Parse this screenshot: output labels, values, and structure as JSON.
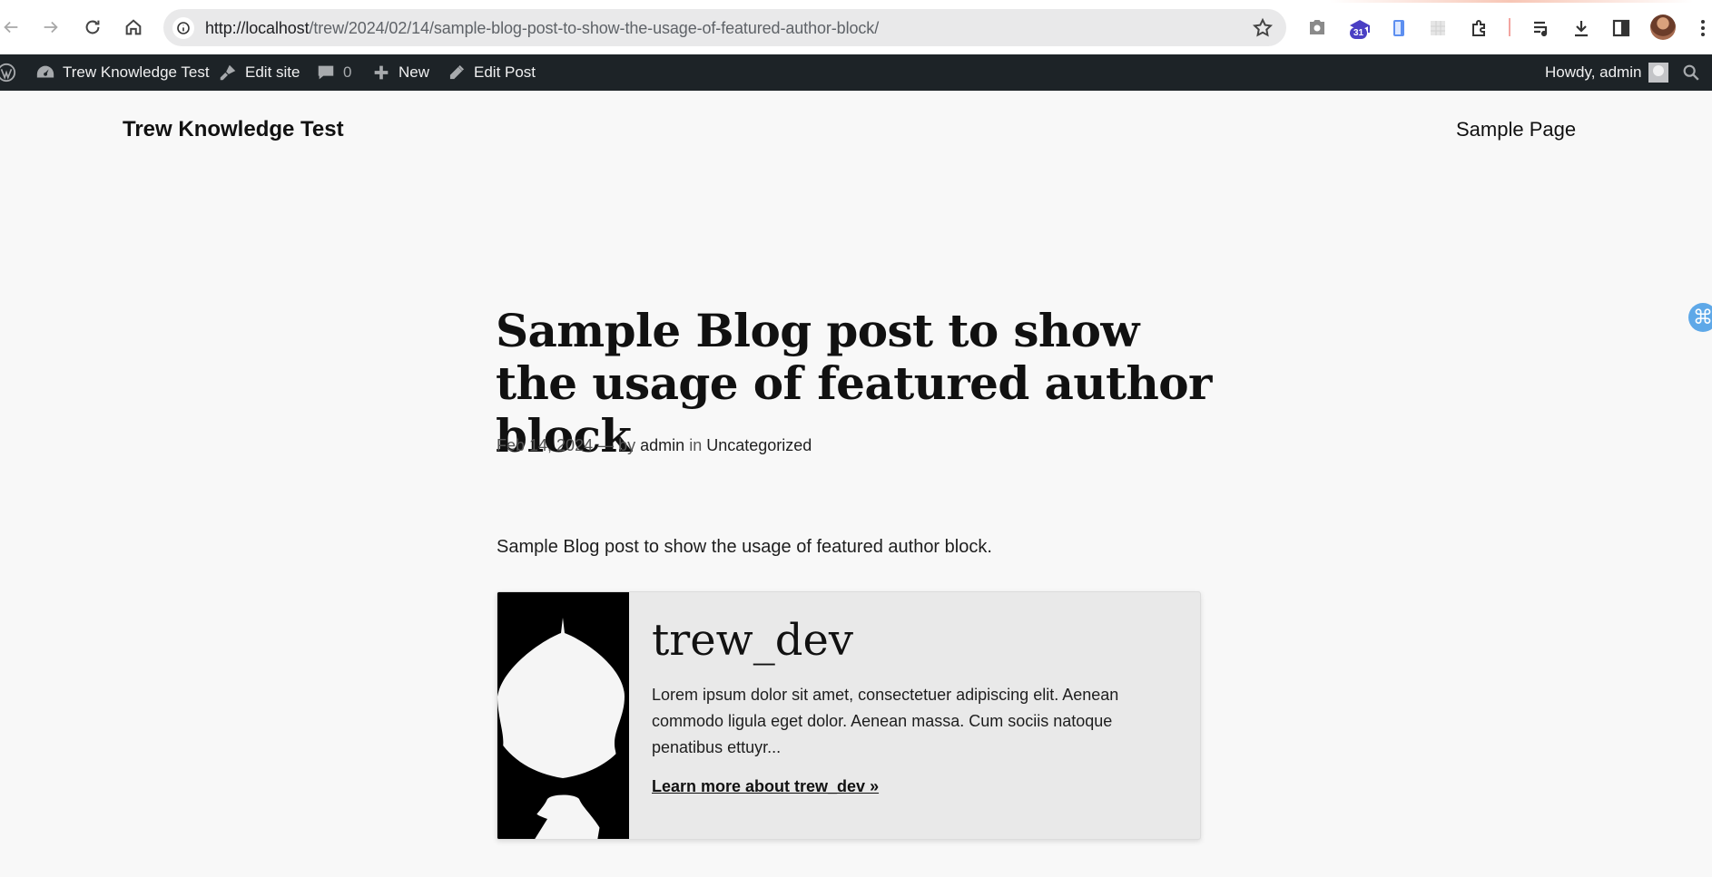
{
  "browser": {
    "url_host": "http://localhost",
    "url_path": "/trew/2024/02/14/sample-blog-post-to-show-the-usage-of-featured-author-block/",
    "extension_badge": "31"
  },
  "admin_bar": {
    "site_name": "Trew Knowledge Test",
    "edit_site": "Edit site",
    "comments_count": "0",
    "new": "New",
    "edit_post": "Edit Post",
    "howdy": "Howdy, admin"
  },
  "site": {
    "title": "Trew Knowledge Test",
    "nav": [
      "Sample Page"
    ]
  },
  "post": {
    "title": "Sample Blog post to show the usage of featured author block",
    "date": "Feb 14, 2024",
    "separator": "—",
    "by": "by",
    "author": "admin",
    "in": "in",
    "category": "Uncategorized",
    "excerpt": "Sample Blog post to show the usage of featured author block."
  },
  "author_card": {
    "name": "trew_dev",
    "bio": "Lorem ipsum dolor sit amet, consectetuer adipiscing elit. Aenean commodo ligula eget dolor. Aenean massa. Cum sociis natoque penatibus ettuyr...",
    "link_label": "Learn more about trew_dev »"
  }
}
